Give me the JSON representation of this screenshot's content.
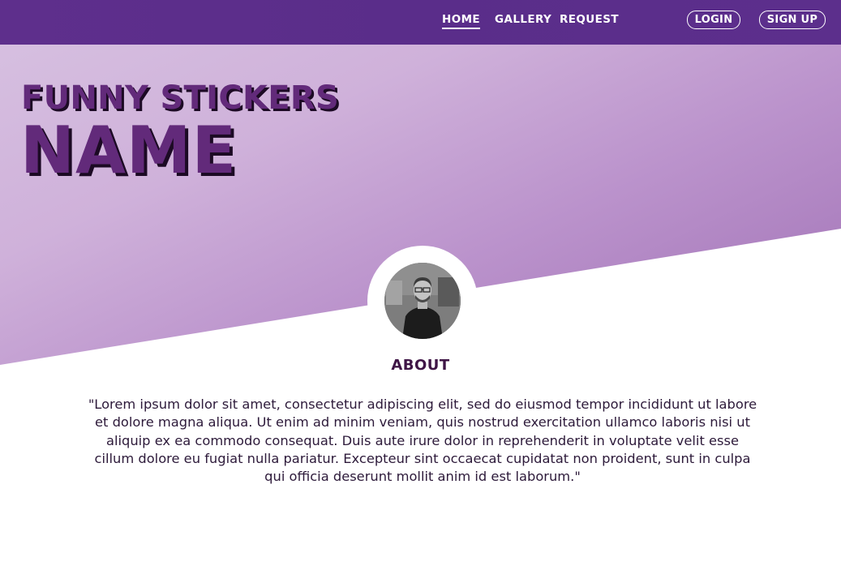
{
  "nav": {
    "links": [
      {
        "label": "HOME",
        "active": true
      },
      {
        "label": "GALLERY",
        "active": false
      },
      {
        "label": "REQUEST",
        "active": false
      }
    ],
    "login_label": "LOGIN",
    "signup_label": "SIGN UP"
  },
  "hero": {
    "line1": "FUNNY STICKERS",
    "line2": "NAME"
  },
  "about": {
    "title": "ABOUT",
    "text": "\"Lorem ipsum dolor sit amet, consectetur adipiscing elit, sed do eiusmod tempor incididunt ut labore et dolore magna aliqua. Ut enim ad minim veniam, quis nostrud exercitation ullamco laboris nisi ut aliquip ex ea commodo consequat. Duis aute irure dolor in reprehenderit in voluptate velit esse cillum dolore eu fugiat nulla pariatur. Excepteur sint occaecat cupidatat non proident, sunt in culpa qui officia deserunt mollit anim id est laborum.\""
  },
  "colors": {
    "nav_bg": "#5c2f8c",
    "brand_text": "#622a7a",
    "hero_light": "#d6bfe0",
    "hero_dark": "#a071b5",
    "about_title": "#3f1546"
  },
  "icons": [
    "profile-photo"
  ]
}
